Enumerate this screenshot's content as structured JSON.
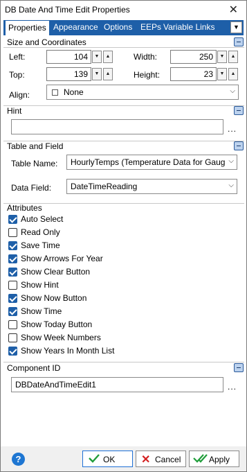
{
  "window": {
    "title": "DB Date And Time Edit Properties"
  },
  "tabs": [
    "Properties",
    "Appearance",
    "Options",
    "EEPs",
    "Variable Links"
  ],
  "size": {
    "header": "Size and Coordinates",
    "left_label": "Left:",
    "left_value": "104",
    "width_label": "Width:",
    "width_value": "250",
    "top_label": "Top:",
    "top_value": "139",
    "height_label": "Height:",
    "height_value": "23",
    "align_label": "Align:",
    "align_value": "None"
  },
  "hint": {
    "header": "Hint",
    "value": "",
    "browse": "..."
  },
  "table": {
    "header": "Table and Field",
    "table_label": "Table Name:",
    "table_value": "HourlyTemps  (Temperature Data for Gaug",
    "field_label": "Data Field:",
    "field_value": "DateTimeReading"
  },
  "attributes": {
    "header": "Attributes",
    "items": [
      {
        "label": "Auto Select",
        "checked": true
      },
      {
        "label": "Read Only",
        "checked": false
      },
      {
        "label": "Save Time",
        "checked": true
      },
      {
        "label": "Show Arrows For Year",
        "checked": true
      },
      {
        "label": "Show Clear Button",
        "checked": true
      },
      {
        "label": "Show Hint",
        "checked": false
      },
      {
        "label": "Show Now Button",
        "checked": true
      },
      {
        "label": "Show Time",
        "checked": true
      },
      {
        "label": "Show Today Button",
        "checked": false
      },
      {
        "label": "Show Week Numbers",
        "checked": false
      },
      {
        "label": "Show Years In Month List",
        "checked": true
      }
    ]
  },
  "component": {
    "header": "Component ID",
    "value": "DBDateAndTimeEdit1",
    "browse": "..."
  },
  "footer": {
    "help": "?",
    "ok": "OK",
    "cancel": "Cancel",
    "apply": "Apply"
  }
}
